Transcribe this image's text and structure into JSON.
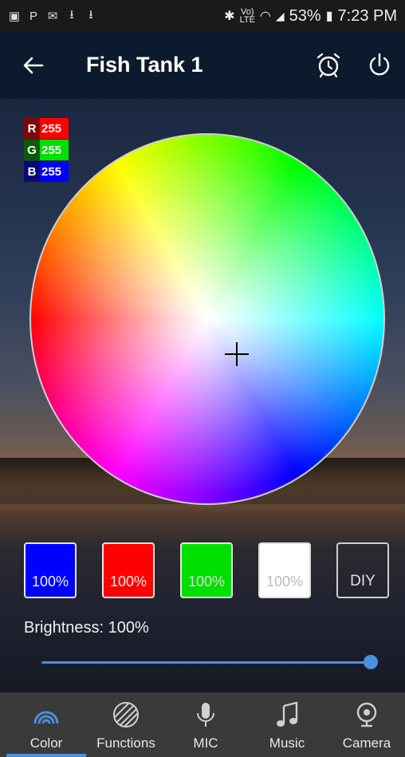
{
  "status_bar": {
    "battery": "53%",
    "time": "7:23 PM",
    "volte": "Vo)",
    "lte": "LTE"
  },
  "header": {
    "title": "Fish Tank 1"
  },
  "rgb": {
    "r_label": "R",
    "r_value": "255",
    "g_label": "G",
    "g_value": "255",
    "b_label": "B",
    "b_value": "255"
  },
  "presets": {
    "blue": "100%",
    "red": "100%",
    "green": "100%",
    "white": "100%",
    "diy": "DIY"
  },
  "brightness": {
    "label": "Brightness: 100%",
    "level_percent": 100
  },
  "nav": {
    "color": "Color",
    "functions": "Functions",
    "mic": "MIC",
    "music": "Music",
    "camera": "Camera",
    "active": "Color"
  },
  "colors": {
    "accent": "#4a90e0",
    "header_bg": "#0d1a2e",
    "nav_bg": "#3a3a3a"
  }
}
